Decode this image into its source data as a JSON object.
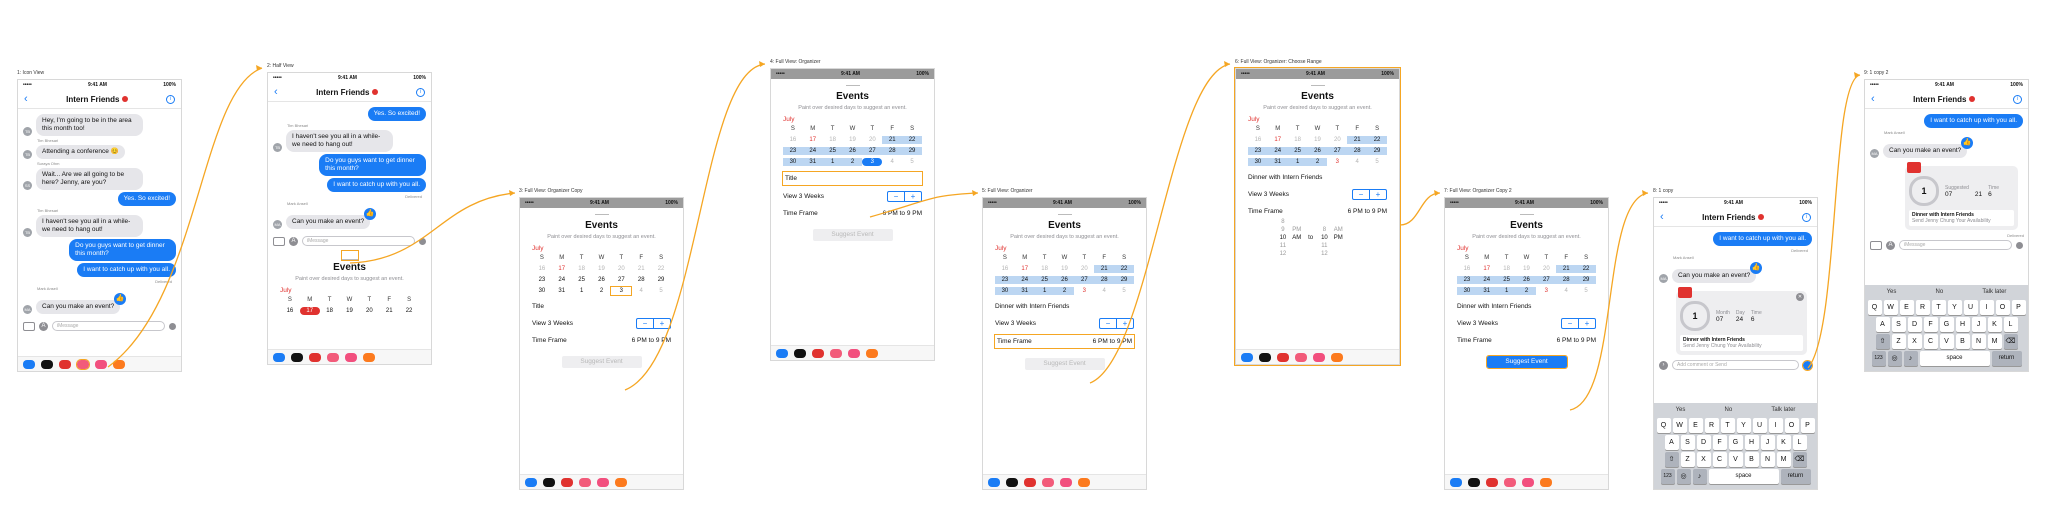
{
  "status": {
    "time": "9:41 AM",
    "battery": "100%",
    "carrier": "•••••"
  },
  "icon_names": [
    "back-icon",
    "info-icon",
    "camera-icon",
    "app-store-icon",
    "mic-icon",
    "thumbs-up-icon",
    "calendar-app-icon",
    "apple-pay-icon",
    "close-icon",
    "send-icon"
  ],
  "colors": {
    "accent": "#1a7cf5",
    "flow_arrow": "#f5a623",
    "red": "#e0322f",
    "highlight": "#bcd6f2"
  },
  "chat": {
    "title": "Intern Friends",
    "placeholder": "iMessage",
    "comment_placeholder": "Add comment or Send",
    "delivered": "Delivered",
    "messages": [
      {
        "sender": "",
        "avatar": "TB",
        "text": "Hey, I'm going to be in the area this month too!"
      },
      {
        "sender": "Tim Bhesari",
        "avatar": "TB",
        "text": "Attending a conference 😊"
      },
      {
        "sender": "Suraya Ohm",
        "avatar": "SS",
        "text": "Wait... Are we all going to be here? Jenny, are you?"
      },
      {
        "sender": "",
        "avatar": "",
        "text": "Yes. So excited!",
        "out": true
      },
      {
        "sender": "Tim Bhesari",
        "avatar": "TB",
        "text": "I haven't see you all in a while- we need to hang out!"
      },
      {
        "sender": "",
        "avatar": "",
        "text": "Do you guys want to get dinner this month?",
        "out": true
      },
      {
        "sender": "",
        "avatar": "",
        "text": "I want to catch up with you all.",
        "out": true
      },
      {
        "sender": "Mark Ansell",
        "avatar": "MA",
        "text": "Can you make an event?"
      }
    ]
  },
  "events": {
    "title": "Events",
    "subtitle": "Paint over desired days to suggest an event.",
    "month": "July",
    "weekdays": [
      "S",
      "M",
      "T",
      "W",
      "T",
      "F",
      "S"
    ],
    "weeks": [
      [
        "16",
        "17",
        "18",
        "19",
        "20",
        "21",
        "22"
      ],
      [
        "23",
        "24",
        "25",
        "26",
        "27",
        "28",
        "29"
      ],
      [
        "30",
        "31",
        "1",
        "2",
        "3",
        "4",
        "5"
      ]
    ],
    "title_label": "Title",
    "title_value": "Dinner with Intern Friends",
    "view_label": "View 3 Weeks",
    "stepper_minus": "−",
    "stepper_plus": "+",
    "timeframe_label": "Time Frame",
    "time_from": "6 PM",
    "time_to_word": "to",
    "time_to": "9 PM",
    "suggest_button": "Suggest Event"
  },
  "picker": {
    "rows": [
      [
        "8",
        "",
        "",
        "",
        "",
        ""
      ],
      [
        "9",
        "PM",
        "",
        "8",
        "AM",
        ""
      ],
      [
        "10",
        "AM",
        "to",
        "10",
        "PM",
        ""
      ],
      [
        "11",
        "",
        "",
        "11",
        "",
        ""
      ],
      [
        "12",
        "",
        "",
        "12",
        "",
        ""
      ]
    ]
  },
  "card": {
    "number": "1",
    "month_label": "Month",
    "day_label": "Day",
    "time_label": "Time",
    "month": "07",
    "day": "24",
    "time": "6",
    "suggested_label": "Suggested",
    "month2": "07",
    "day2": "21",
    "time2": "6",
    "event_title": "Dinner with Intern Friends",
    "event_sub": "Send Jenny Chung Your Availability"
  },
  "keyboard": {
    "suggestions": [
      "Yes",
      "No",
      "Talk later"
    ],
    "rows": [
      [
        "Q",
        "W",
        "E",
        "R",
        "T",
        "Y",
        "U",
        "I",
        "O",
        "P"
      ],
      [
        "A",
        "S",
        "D",
        "F",
        "G",
        "H",
        "J",
        "K",
        "L"
      ],
      [
        "Z",
        "X",
        "C",
        "V",
        "B",
        "N",
        "M"
      ]
    ],
    "space": "space",
    "return": "return",
    "numbers": "123"
  },
  "screens": [
    {
      "label": "1: Icon View"
    },
    {
      "label": "2: Half View"
    },
    {
      "label": "3: Full View: Organizer Copy"
    },
    {
      "label": "4: Full View: Organizer"
    },
    {
      "label": "5: Full View: Organizer"
    },
    {
      "label": "6: Full View: Organizer: Choose Range"
    },
    {
      "label": "7: Full View: Organizer Copy 2"
    },
    {
      "label": "8: 1 copy"
    },
    {
      "label": "9: 1 copy 2"
    }
  ]
}
